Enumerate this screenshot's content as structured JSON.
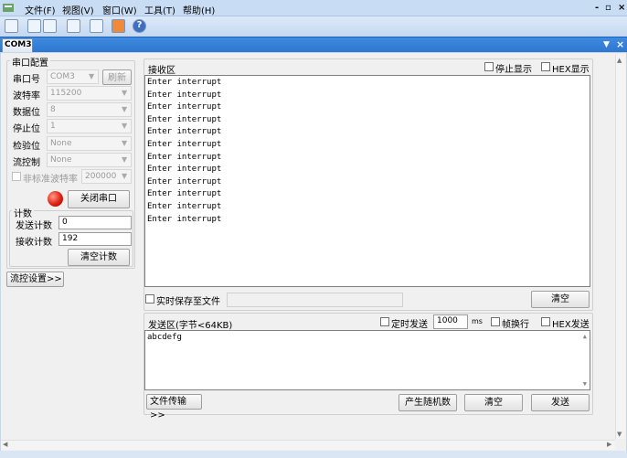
{
  "menus": [
    "文件(F)",
    "视图(V)",
    "窗口(W)",
    "工具(T)",
    "帮助(H)"
  ],
  "window_controls": {
    "min": "-",
    "restore": "▫",
    "close": "×"
  },
  "tab": {
    "label": "COM3"
  },
  "serial_config": {
    "title": "串口配置",
    "port_label": "串口号",
    "port_value": "COM3",
    "refresh_label": "刷新",
    "baud_label": "波特率",
    "baud_value": "115200",
    "data_bits_label": "数据位",
    "data_bits_value": "8",
    "stop_bits_label": "停止位",
    "stop_bits_value": "1",
    "parity_label": "检验位",
    "parity_value": "None",
    "flow_label": "流控制",
    "flow_value": "None",
    "nonstd_label": "非标准波特率",
    "nonstd_value": "200000",
    "close_port_label": "关闭串口",
    "status_color": "#e02010"
  },
  "counters": {
    "title": "计数",
    "sent_label": "发送计数",
    "sent_value": "0",
    "recv_label": "接收计数",
    "recv_value": "192",
    "clear_label": "清空计数"
  },
  "flow_settings_label": "流控设置>>",
  "receive": {
    "title": "接收区",
    "stop_display_label": "停止显示",
    "hex_display_label": "HEX显示",
    "lines": [
      "Enter interrupt",
      "Enter interrupt",
      "Enter interrupt",
      "Enter interrupt",
      "Enter interrupt",
      "Enter interrupt",
      "Enter interrupt",
      "Enter interrupt",
      "Enter interrupt",
      "Enter interrupt",
      "Enter interrupt",
      "Enter interrupt"
    ],
    "save_to_file_label": "实时保存至文件",
    "clear_label": "清空"
  },
  "send": {
    "title": "发送区(字节<64KB)",
    "timed_send_label": "定时发送",
    "interval_value": "1000",
    "unit": "ms",
    "newline_label": "帧换行",
    "hex_send_label": "HEX发送",
    "content": "abcdefg",
    "file_transfer_label": "文件传输>>",
    "random_label": "产生随机数",
    "clear_label": "清空",
    "send_label": "发送"
  }
}
